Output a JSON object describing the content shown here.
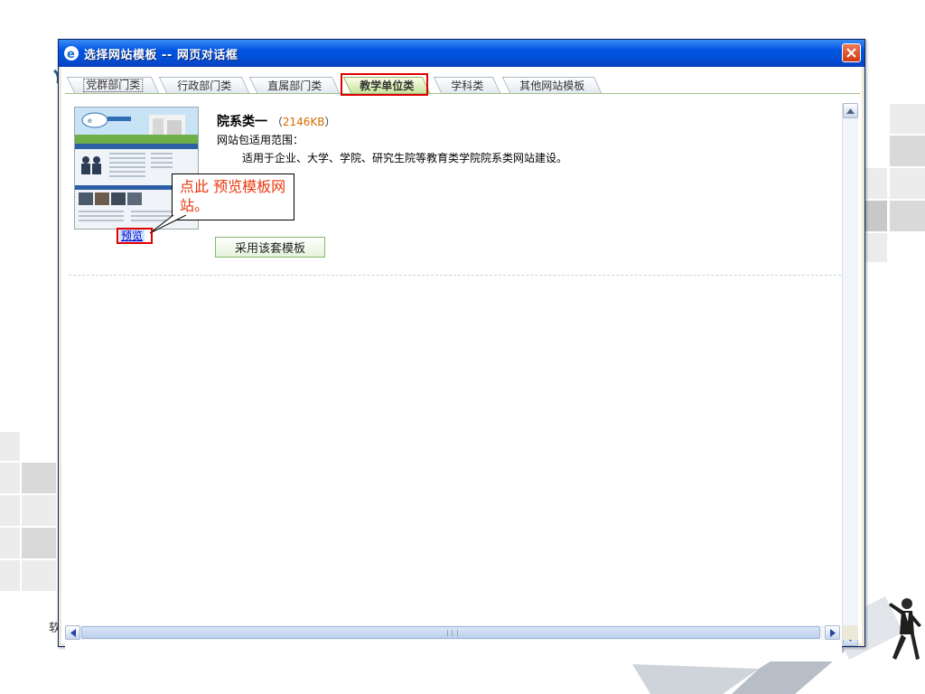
{
  "window": {
    "title": "选择网站模板 -- 网页对话框"
  },
  "tabs": [
    {
      "label": "党群部门类"
    },
    {
      "label": "行政部门类"
    },
    {
      "label": "直属部门类"
    },
    {
      "label": "教学单位类"
    },
    {
      "label": "学科类"
    },
    {
      "label": "其他网站模板"
    }
  ],
  "active_tab": "教学单位类",
  "template": {
    "name": "院系类一",
    "size_open": "（",
    "size": "2146KB",
    "size_close": "）",
    "scope_label": "网站包适用范围：",
    "scope_text": "适用于企业、大学、学院、研究生院等教育类学院院系类网站建设。",
    "preview_label": "预览",
    "use_button": "采用该套模板"
  },
  "callout": {
    "text": "点此 预览模板网站。"
  },
  "side_char": "软",
  "colors": {
    "titlebar": "#0054e3",
    "accent_red": "#e00000",
    "callout_text": "#e8380d",
    "button_border": "#86b86a"
  },
  "icons": [
    "ie-icon",
    "close-icon",
    "scroll-up-icon",
    "scroll-down-icon",
    "scroll-left-icon",
    "scroll-right-icon"
  ]
}
